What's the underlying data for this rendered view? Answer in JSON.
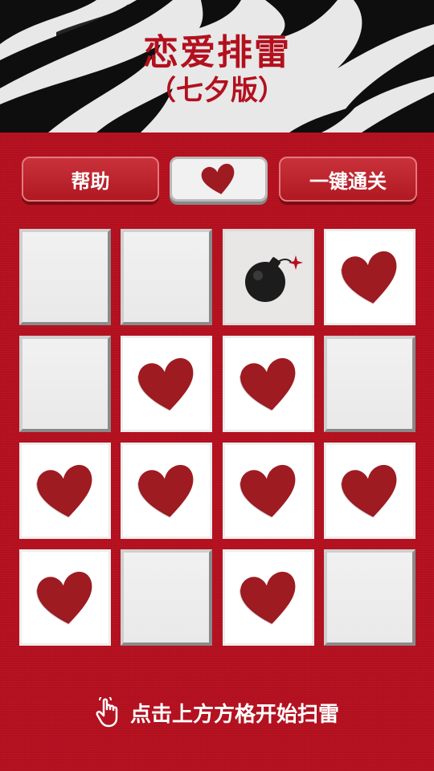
{
  "header": {
    "title": "恋爱排雷",
    "subtitle": "（七夕版）"
  },
  "toolbar": {
    "help_label": "帮助",
    "heart_icon": "heart-icon",
    "pass_label": "一键通关"
  },
  "colors": {
    "brand_red": "#b3101e",
    "heart_red": "#9e1b22",
    "tile_gray": "#eeeeee"
  },
  "grid": {
    "rows": 4,
    "cols": 4,
    "cells": [
      "hidden",
      "hidden",
      "bomb",
      "heart",
      "hidden",
      "heart",
      "heart",
      "hidden",
      "heart",
      "heart",
      "heart",
      "heart",
      "heart",
      "hidden",
      "heart",
      "hidden"
    ]
  },
  "hint": {
    "icon": "tap-hand-icon",
    "text": "点击上方方格开始扫雷"
  }
}
